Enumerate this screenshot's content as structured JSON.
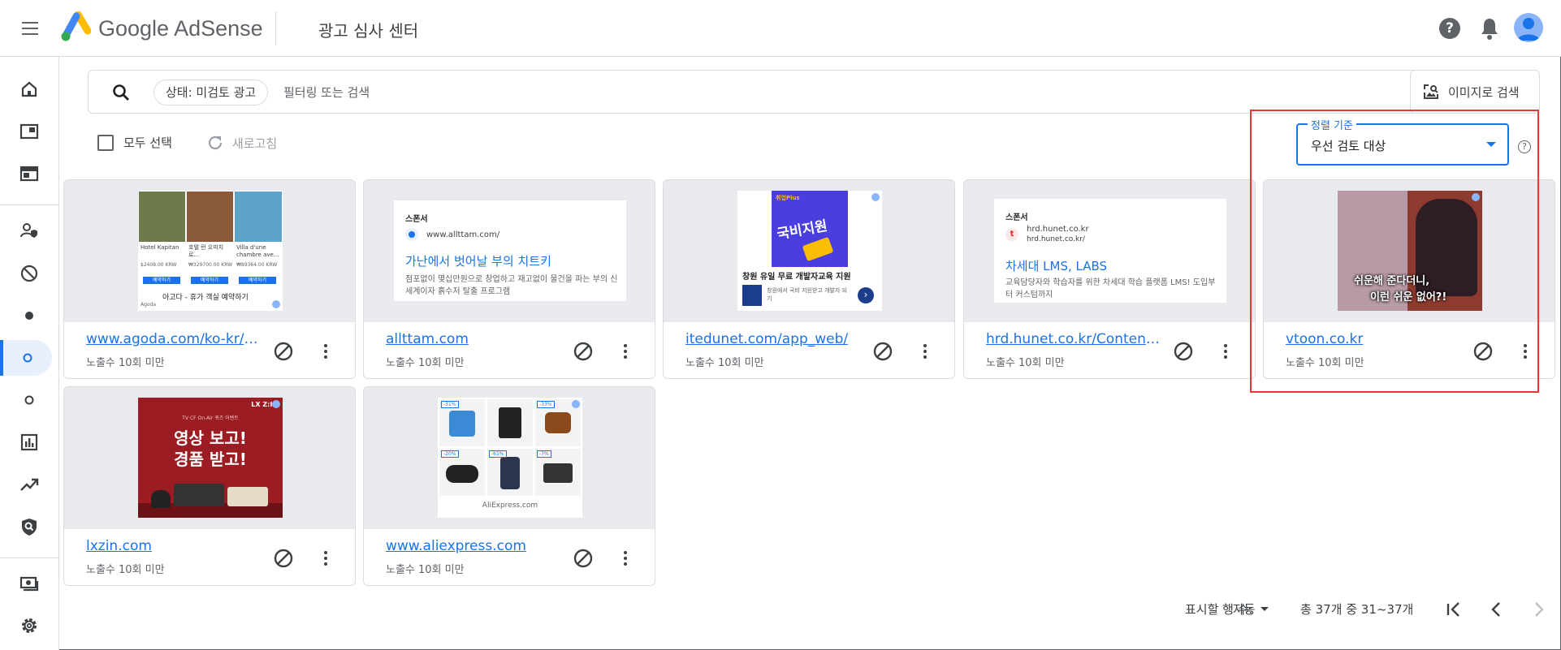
{
  "app": {
    "brand": "Google AdSense",
    "page_title": "광고 심사 센터"
  },
  "search": {
    "chip": "상태: 미검토 광고",
    "placeholder": "필터링 또는 검색",
    "image_search_label": "이미지로 검색"
  },
  "toolbar": {
    "select_all": "모두 선택",
    "refresh": "새로고침"
  },
  "sort": {
    "label": "정렬 기준",
    "value": "우선 검토 대상"
  },
  "cards": [
    {
      "url": "www.agoda.com/ko-kr/pa...",
      "meta": "노출수 10회 미만",
      "creative": {
        "hotels": [
          "Hotel Kapitan",
          "호텔 런 오피치로...",
          "Villa d'une chambre ave..."
        ],
        "prices": [
          "$2408.00 KRW",
          "₩329700.00 KRW",
          "₩89364.00 KRW"
        ],
        "book": "예약하기",
        "caption": "아고다 - 휴가 객실 예약하기",
        "brand": "Agoda"
      }
    },
    {
      "url": "allttam.com",
      "meta": "노출수 10회 미만",
      "creative": {
        "sponsor": "스폰서",
        "domain": "www.allttam.com/",
        "headline": "가난에서 벗어날 부의 치트키",
        "desc": "점포없이 몇십만원으로 창업하고 재고없이 물건을 파는 부의 신세계이자 흙수저 탈출 프로그램"
      }
    },
    {
      "url": "itedunet.com/app_web/",
      "meta": "노출수 10회 미만",
      "creative": {
        "badge": "취업Plus",
        "big_text": "국비지원",
        "headline": "창원 유일 무료 개발자교육 지원",
        "sub": "창원에서 국비 지원받고 개발자 되기"
      }
    },
    {
      "url": "hrd.hunet.co.kr/Contents/...",
      "meta": "노출수 10회 미만",
      "creative": {
        "sponsor": "스폰서",
        "domain": "hrd.hunet.co.kr",
        "domain2": "hrd.hunet.co.kr/",
        "headline": "차세대 LMS, LABS",
        "desc": "교육담당자와 학습자를 위한 차세대 학습 플랫폼 LMS! 도입부터 커스텀까지"
      }
    },
    {
      "url": "vtoon.co.kr",
      "meta": "노출수 10회 미만",
      "creative": {
        "line1": "쉬운해 준다더니,",
        "line2": "이런 쉬운 없어?!"
      }
    },
    {
      "url": "lxzin.com",
      "meta": "노출수 10회 미만",
      "creative": {
        "brand": "LX Z:IN",
        "small": "TV CF On-Air 퀴즈 이벤트",
        "line1": "영상 보고!",
        "line2": "경품 받고!"
      }
    },
    {
      "url": "www.aliexpress.com",
      "meta": "노출수 10회 미만",
      "creative": {
        "tags": [
          "-31%",
          "-33%",
          "-20%",
          "-61%",
          "-7%"
        ],
        "brand": "AliExpress.com"
      }
    }
  ],
  "pagination": {
    "rows_label": "표시할 행 수:",
    "rows_value": "자동",
    "range": "총 37개 중 31~37개"
  },
  "colors": {
    "accent": "#1a73e8",
    "highlight": "#e53935",
    "preview_bg": "#e8eaed"
  }
}
